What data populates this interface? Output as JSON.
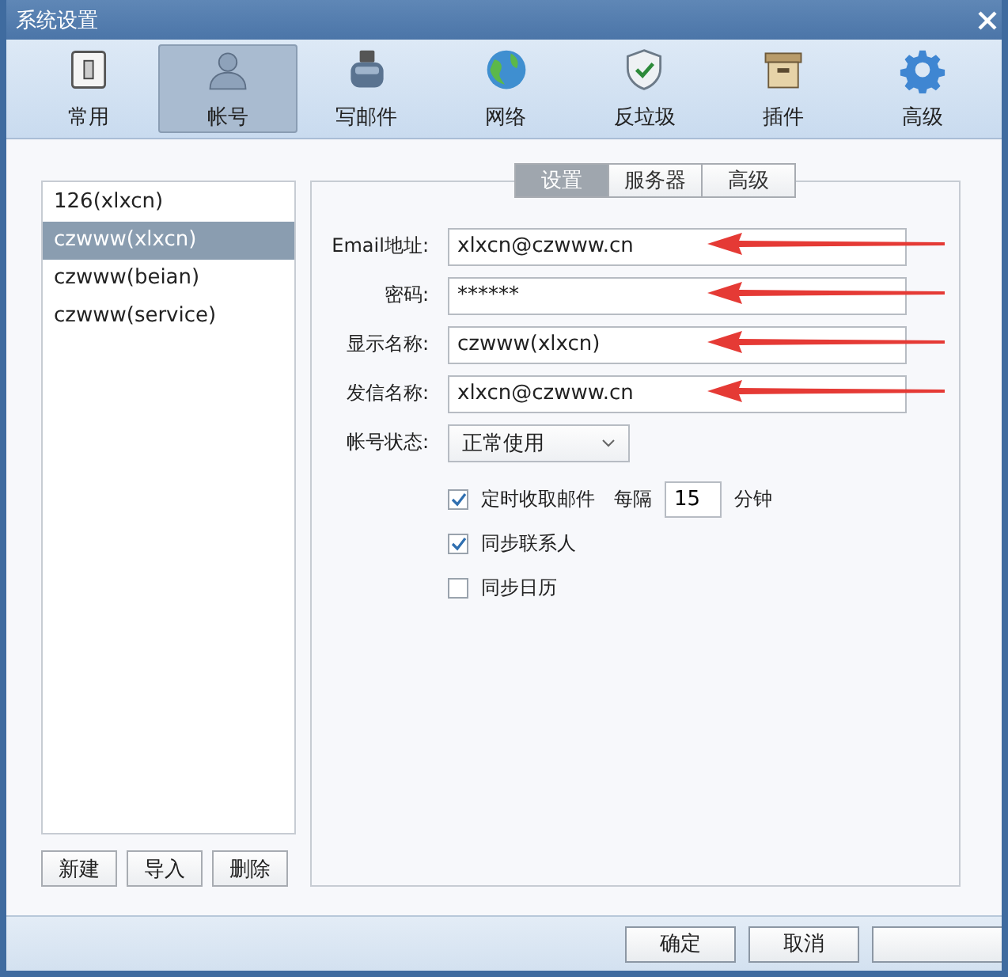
{
  "window": {
    "title": "系统设置"
  },
  "toolbar": [
    {
      "label": "常用",
      "kind": "switch",
      "selected": false
    },
    {
      "label": "帐号",
      "kind": "user",
      "selected": true
    },
    {
      "label": "写邮件",
      "kind": "ink",
      "selected": false
    },
    {
      "label": "网络",
      "kind": "globe",
      "selected": false
    },
    {
      "label": "反垃圾",
      "kind": "shield",
      "selected": false
    },
    {
      "label": "插件",
      "kind": "box",
      "selected": false
    },
    {
      "label": "高级",
      "kind": "gear",
      "selected": false
    }
  ],
  "accounts": [
    {
      "name": "126(xlxcn)",
      "selected": false
    },
    {
      "name": "czwww(xlxcn)",
      "selected": true
    },
    {
      "name": "czwww(beian)",
      "selected": false
    },
    {
      "name": "czwww(service)",
      "selected": false
    }
  ],
  "account_buttons": [
    "新建",
    "导入",
    "删除"
  ],
  "tabs": [
    {
      "label": "设置",
      "selected": true
    },
    {
      "label": "服务器",
      "selected": false
    },
    {
      "label": "高级",
      "selected": false
    }
  ],
  "fields": [
    {
      "label": "Email地址:",
      "value": "xlxcn@czwww.cn"
    },
    {
      "label": "密码:",
      "value": "******"
    },
    {
      "label": "显示名称:",
      "value": "czwww(xlxcn)"
    },
    {
      "label": "发信名称:",
      "value": "xlxcn@czwww.cn"
    }
  ],
  "status": {
    "label": "帐号状态:",
    "value": "正常使用"
  },
  "options": [
    {
      "label": "定时收取邮件",
      "checked": true,
      "interval": {
        "prefix": "每隔",
        "value": "15",
        "suffix": "分钟"
      }
    },
    {
      "label": "同步联系人",
      "checked": true
    },
    {
      "label": "同步日历",
      "checked": false
    }
  ],
  "footer_buttons": [
    "确定",
    "取消"
  ]
}
